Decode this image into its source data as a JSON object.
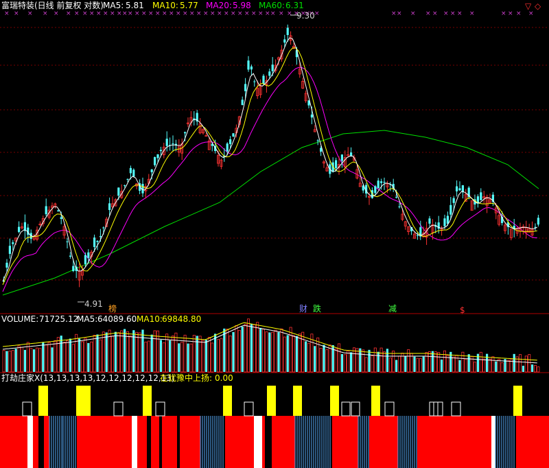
{
  "header": {
    "title": "富瑞特装(日线 前复权 对数)",
    "ma5_label": "MA5:",
    "ma5_value": "5.81",
    "ma10_label": "MA10:",
    "ma10_value": "5.77",
    "ma20_label": "MA20:",
    "ma20_value": "5.98",
    "ma60_label": "MA60:",
    "ma60_value": "6.31"
  },
  "price_annotations": {
    "high_label": "9.30",
    "low_label": "4.91",
    "event_labels": [
      "榜",
      "财",
      "跌",
      "减",
      "$"
    ]
  },
  "volume_header": {
    "volume_label": "VOLUME:",
    "volume_value": "71725.12",
    "ma5_label": "MA5:",
    "ma5_value": "64089.60",
    "ma10_label": "MA10:",
    "ma10_value": "69848.80"
  },
  "indicator_header": {
    "name": "打劫庄家X(13,13,13,13,12,12,12,12,12,13)",
    "label": "在犹豫中上扬:",
    "value": "0.00"
  },
  "colors": {
    "up": "#ff3232",
    "down": "#54fcfc",
    "ma5": "#ffffff",
    "ma10": "#ffff00",
    "ma20": "#ff00ff",
    "ma60": "#00e000",
    "grid": "#7a0000",
    "red_block": "#ff0000",
    "yellow_block": "#ffff00"
  },
  "chart_data": {
    "type": "candlestick",
    "price_range": [
      4.5,
      9.5
    ],
    "y_scale": "log",
    "high": 9.3,
    "low": 4.91,
    "series": [
      {
        "name": "MA5",
        "last": 5.81
      },
      {
        "name": "MA10",
        "last": 5.77
      },
      {
        "name": "MA20",
        "last": 5.98
      },
      {
        "name": "MA60",
        "last": 6.31
      },
      {
        "name": "VOLUME",
        "last": 71725.12
      },
      {
        "name": "VOL MA5",
        "last": 64089.6
      },
      {
        "name": "VOL MA10",
        "last": 69848.8
      }
    ]
  }
}
